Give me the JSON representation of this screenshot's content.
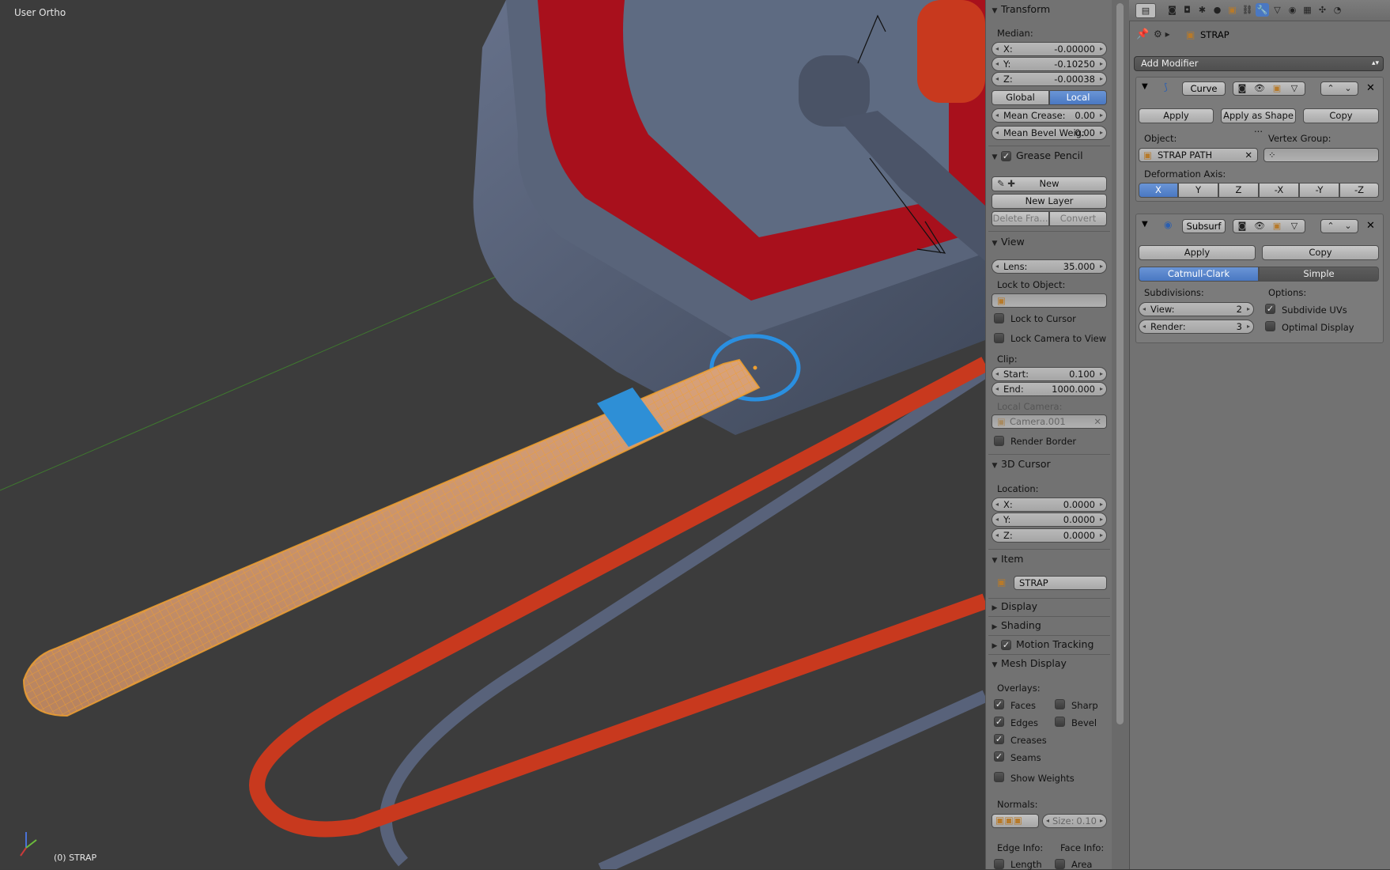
{
  "viewport": {
    "view_name": "User Ortho",
    "object_info": "(0) STRAP"
  },
  "npanel": {
    "transform": {
      "title": "Transform",
      "median_label": "Median:",
      "x": {
        "label": "X:",
        "value": "-0.00000"
      },
      "y": {
        "label": "Y:",
        "value": "-0.10250"
      },
      "z": {
        "label": "Z:",
        "value": "-0.00038"
      },
      "global": "Global",
      "local": "Local",
      "mean_crease": {
        "label": "Mean Crease:",
        "value": "0.00"
      },
      "mean_bevel": {
        "label": "Mean Bevel Weig:",
        "value": "0.00"
      }
    },
    "grease_pencil": {
      "title": "Grease Pencil",
      "new": "New",
      "new_layer": "New Layer",
      "delete_frame": "Delete Fra...",
      "convert": "Convert"
    },
    "view": {
      "title": "View",
      "lens": {
        "label": "Lens:",
        "value": "35.000"
      },
      "lock_to_object": "Lock to Object:",
      "lock_to_cursor": "Lock to Cursor",
      "lock_camera": "Lock Camera to View",
      "clip": "Clip:",
      "start": {
        "label": "Start:",
        "value": "0.100"
      },
      "end": {
        "label": "End:",
        "value": "1000.000"
      },
      "local_camera": "Local Camera:",
      "camera_name": "Camera.001",
      "render_border": "Render Border"
    },
    "cursor": {
      "title": "3D Cursor",
      "location": "Location:",
      "x": {
        "label": "X:",
        "value": "0.0000"
      },
      "y": {
        "label": "Y:",
        "value": "0.0000"
      },
      "z": {
        "label": "Z:",
        "value": "0.0000"
      }
    },
    "item": {
      "title": "Item",
      "name": "STRAP"
    },
    "display": {
      "title": "Display"
    },
    "shading": {
      "title": "Shading"
    },
    "motion_tracking": {
      "title": "Motion Tracking"
    },
    "mesh_display": {
      "title": "Mesh Display",
      "overlays": "Overlays:",
      "faces": "Faces",
      "sharp": "Sharp",
      "edges": "Edges",
      "bevel": "Bevel",
      "creases": "Creases",
      "seams": "Seams",
      "show_weights": "Show Weights",
      "normals": "Normals:",
      "size": {
        "label": "Size:",
        "value": "0.10"
      },
      "edge_info": "Edge Info:",
      "face_info": "Face Info:",
      "length": "Length",
      "area": "Area"
    }
  },
  "properties": {
    "object_name": "STRAP",
    "add_modifier": "Add Modifier",
    "curve": {
      "name": "Curve",
      "apply": "Apply",
      "apply_shape": "Apply as Shape ...",
      "copy": "Copy",
      "object_label": "Object:",
      "object_value": "STRAP PATH",
      "vertex_group_label": "Vertex Group:",
      "deformation_axis": "Deformation Axis:",
      "axes": [
        "X",
        "Y",
        "Z",
        "-X",
        "-Y",
        "-Z"
      ]
    },
    "subsurf": {
      "name": "Subsurf",
      "apply": "Apply",
      "copy": "Copy",
      "catmull": "Catmull-Clark",
      "simple": "Simple",
      "subdivisions": "Subdivisions:",
      "options": "Options:",
      "view": {
        "label": "View:",
        "value": "2"
      },
      "render": {
        "label": "Render:",
        "value": "3"
      },
      "subdivide_uvs": "Subdivide UVs",
      "optimal_display": "Optimal Display"
    }
  },
  "colors": {
    "selection": "#f0a030",
    "accent": "#4a78c2",
    "cable": "#c8391e",
    "body": "#535e72",
    "top": "#a8101c"
  }
}
